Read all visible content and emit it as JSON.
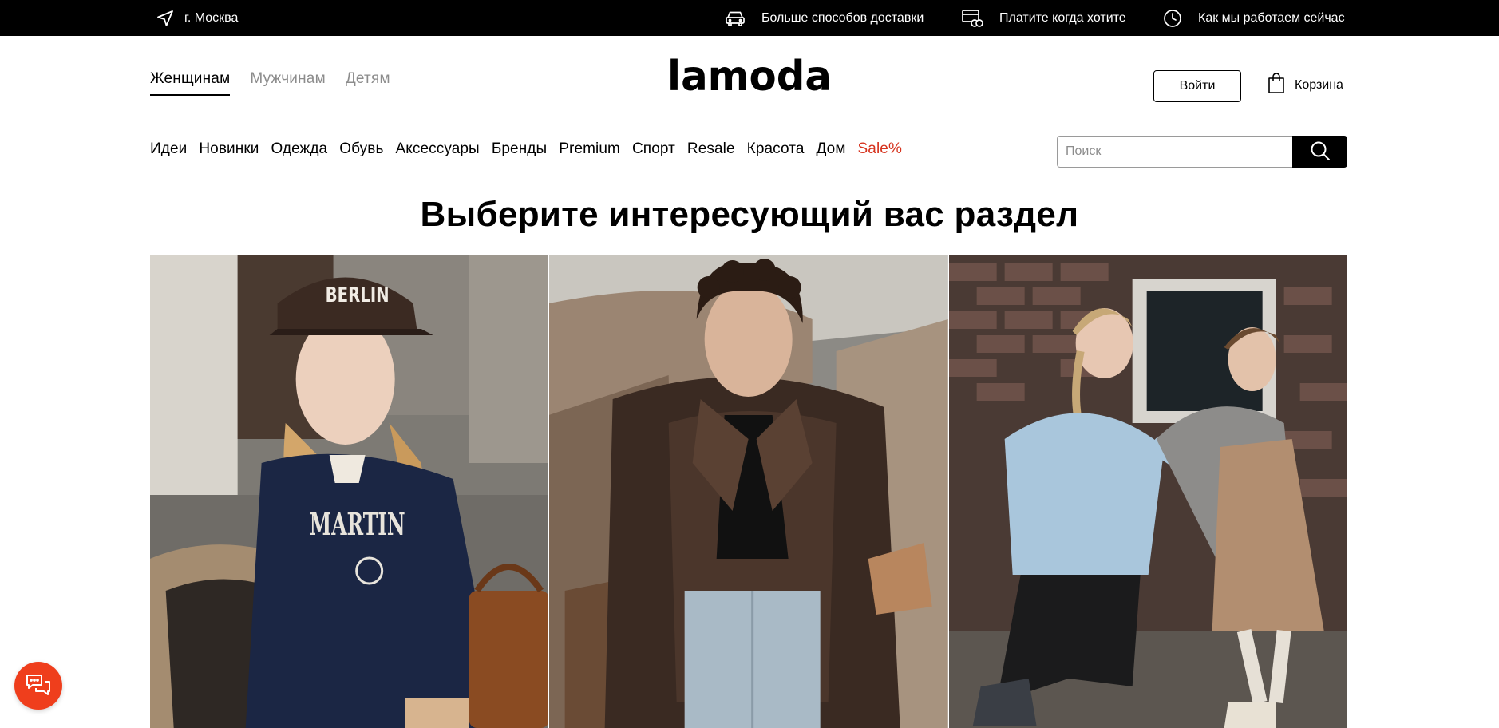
{
  "topbar": {
    "city": "г. Москва",
    "items": [
      {
        "icon": "car-icon",
        "label": "Больше способов доставки"
      },
      {
        "icon": "card-icon",
        "label": "Платите когда хотите"
      },
      {
        "icon": "clock-icon",
        "label": "Как мы работаем сейчас"
      }
    ]
  },
  "header": {
    "gender_tabs": [
      "Женщинам",
      "Мужчинам",
      "Детям"
    ],
    "active_tab": "Женщинам",
    "logo_text": "lamoda",
    "login_label": "Войти",
    "cart_label": "Корзина"
  },
  "nav": {
    "categories": [
      "Идеи",
      "Новинки",
      "Одежда",
      "Обувь",
      "Аксессуары",
      "Бренды",
      "Premium",
      "Спорт",
      "Resale",
      "Красота",
      "Дом",
      "Sale%"
    ]
  },
  "search": {
    "placeholder": "Поиск",
    "value": ""
  },
  "main": {
    "title": "Выберите интересующий вас раздел",
    "cards": [
      {
        "name": "women",
        "cap_text": "BERLIN",
        "sweater_text": "MARTIN"
      },
      {
        "name": "men"
      },
      {
        "name": "kids"
      }
    ]
  },
  "colors": {
    "topbar_bg": "#000000",
    "sale": "#d6331e",
    "chat_button": "#ef3e1c",
    "text_muted": "#8c8c8c"
  }
}
